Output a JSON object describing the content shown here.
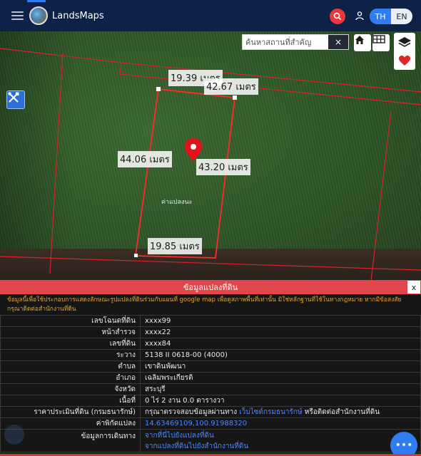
{
  "header": {
    "brand": "LandsMaps",
    "lang_th": "TH",
    "lang_en": "EN",
    "accent_color": "#2f7df1",
    "icons": [
      "menu-icon",
      "logo-icon",
      "search-icon",
      "user-icon"
    ]
  },
  "map": {
    "search_placeholder": "ค้นหาสถานที่สำคัญ",
    "clear_label": "×",
    "measurements": {
      "top_left": "19.39 เมตร",
      "top_right": "42.67 เมตร",
      "left": "44.06 เมตร",
      "right": "43.20 เมตร",
      "bottom": "19.85 เมตร"
    },
    "parcel_label": "ค่าแปลงนะ",
    "icons": [
      "home-icon",
      "grid-icon",
      "layers-icon",
      "heart-icon",
      "tools-icon",
      "location-pin-icon"
    ]
  },
  "panel": {
    "title": "ข้อมูลแปลงที่ดิน",
    "close_label": "x",
    "disclaimer": "ข้อมูลนี้เพื่อใช้ประกอบการแสดงลักษณะรูปแปลงที่ดินร่วมกับแผนที่ google map เพื่อดูสภาพพื้นที่เท่านั้น มิใช่หลักฐานที่ใช้ในทางกฎหมาย หากมีข้อสงสัย กรุณาติดต่อสำนักงานที่ดิน",
    "rows": [
      {
        "label": "เลขโฉนดที่ดิน",
        "value": "xxxx99"
      },
      {
        "label": "หน้าสำรวจ",
        "value": "xxxx22"
      },
      {
        "label": "เลขที่ดิน",
        "value": "xxxx84"
      },
      {
        "label": "ระวาง",
        "value": "5138 II 0618-00 (4000)"
      },
      {
        "label": "ตำบล",
        "value": "เขาดินพัฒนา"
      },
      {
        "label": "อำเภอ",
        "value": "เฉลิมพระเกียรติ"
      },
      {
        "label": "จังหวัด",
        "value": "สระบุรี"
      },
      {
        "label": "เนื้อที่",
        "value": "0 ไร่ 2 งาน 0.0 ตารางวา"
      }
    ],
    "appraisal": {
      "label": "ราคาประเมินที่ดิน (กรมธนารักษ์)",
      "prefix": "กรุณาตรวจสอบข้อมูลผ่านทาง ",
      "link": "เว็บไซต์กรมธนารักษ์",
      "suffix": " หรือติดต่อสำนักงานที่ดิน"
    },
    "coords": {
      "label": "ค่าพิกัดแปลง",
      "value": "14.63469109,100.91988320"
    },
    "travel": {
      "label": "ข้อมูลการเดินทาง",
      "link1": "จากที่นี่ไปยังแปลงที่ดิน",
      "link2": "จากแปลงที่ดินไปยังสำนักงานที่ดิน"
    },
    "fab_label": "•••",
    "status_color": "#e0474b"
  }
}
